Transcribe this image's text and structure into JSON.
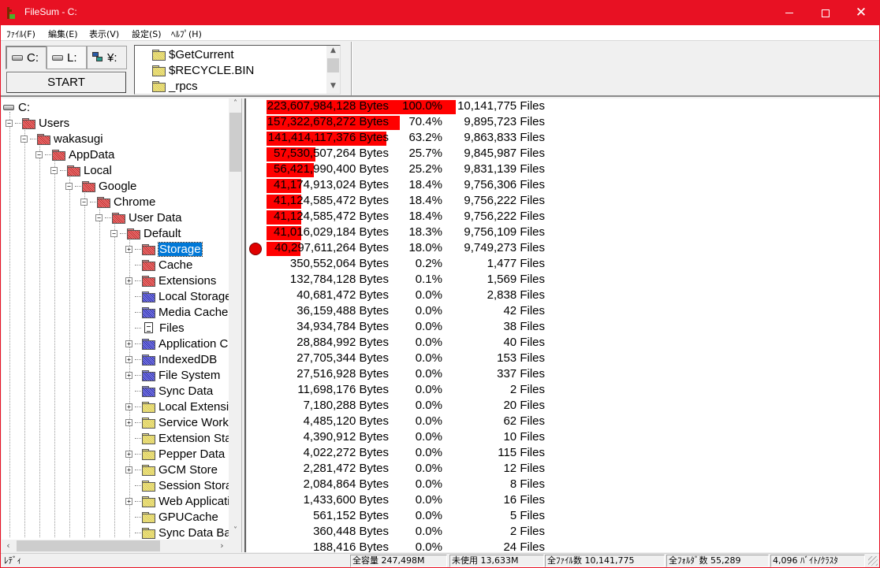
{
  "window": {
    "title": "FileSum - C:",
    "controls": {
      "minimize": "—",
      "maximize": "☐",
      "close": "✕"
    },
    "accent_color": "#e81123"
  },
  "menu": [
    {
      "label": "ﾌｧｲﾙ(F)"
    },
    {
      "label": "編集(E)"
    },
    {
      "label": "表示(V)"
    },
    {
      "label": "設定(S)"
    },
    {
      "label": "ﾍﾙﾌﾟ(H)"
    }
  ],
  "toolbar": {
    "drive_tabs": [
      {
        "label": "C:",
        "icon": "hdd-icon",
        "active": true
      },
      {
        "label": "L:",
        "icon": "hdd-icon",
        "active": false
      },
      {
        "label": "¥:",
        "icon": "network-drive-icon",
        "active": false
      }
    ],
    "start_label": "START",
    "folder_list": [
      {
        "name": "$GetCurrent"
      },
      {
        "name": "$RECYCLE.BIN"
      },
      {
        "name": "_rpcs"
      }
    ]
  },
  "tree": {
    "root": "C:",
    "items": [
      {
        "label": "Users",
        "depth": 1,
        "expander": "minus",
        "color": "red"
      },
      {
        "label": "wakasugi",
        "depth": 2,
        "expander": "minus",
        "color": "red"
      },
      {
        "label": "AppData",
        "depth": 3,
        "expander": "minus",
        "color": "red"
      },
      {
        "label": "Local",
        "depth": 4,
        "expander": "minus",
        "color": "red"
      },
      {
        "label": "Google",
        "depth": 5,
        "expander": "minus",
        "color": "red"
      },
      {
        "label": "Chrome",
        "depth": 6,
        "expander": "minus",
        "color": "red"
      },
      {
        "label": "User Data",
        "depth": 7,
        "expander": "minus",
        "color": "red"
      },
      {
        "label": "Default",
        "depth": 8,
        "expander": "minus",
        "color": "red"
      },
      {
        "label": "Storage",
        "depth": 9,
        "expander": "plus",
        "color": "red",
        "selected": true
      },
      {
        "label": "Cache",
        "depth": 9,
        "expander": "none",
        "color": "red"
      },
      {
        "label": "Extensions",
        "depth": 9,
        "expander": "plus",
        "color": "red"
      },
      {
        "label": "Local Storage",
        "depth": 9,
        "expander": "none",
        "color": "blue"
      },
      {
        "label": "Media Cache",
        "depth": 9,
        "expander": "none",
        "color": "blue"
      },
      {
        "label": "Files",
        "depth": 9,
        "expander": "none",
        "color": "file"
      },
      {
        "label": "Application C",
        "depth": 9,
        "expander": "plus",
        "color": "blue"
      },
      {
        "label": "IndexedDB",
        "depth": 9,
        "expander": "plus",
        "color": "blue"
      },
      {
        "label": "File System",
        "depth": 9,
        "expander": "plus",
        "color": "blue"
      },
      {
        "label": "Sync Data",
        "depth": 9,
        "expander": "none",
        "color": "blue"
      },
      {
        "label": "Local Extensic",
        "depth": 9,
        "expander": "plus",
        "color": "yellow"
      },
      {
        "label": "Service Worke",
        "depth": 9,
        "expander": "plus",
        "color": "yellow"
      },
      {
        "label": "Extension Stat",
        "depth": 9,
        "expander": "none",
        "color": "yellow"
      },
      {
        "label": "Pepper Data",
        "depth": 9,
        "expander": "plus",
        "color": "yellow"
      },
      {
        "label": "GCM Store",
        "depth": 9,
        "expander": "plus",
        "color": "yellow"
      },
      {
        "label": "Session Stora",
        "depth": 9,
        "expander": "none",
        "color": "yellow"
      },
      {
        "label": "Web Applicati",
        "depth": 9,
        "expander": "plus",
        "color": "yellow"
      },
      {
        "label": "GPUCache",
        "depth": 9,
        "expander": "none",
        "color": "yellow"
      },
      {
        "label": "Sync Data Ba",
        "depth": 9,
        "expander": "none",
        "color": "yellow"
      }
    ]
  },
  "list": {
    "bar_color": "#ff0000",
    "rows": [
      {
        "bytes": "223,607,984,128 Bytes",
        "percent": "100.0%",
        "fraction": 1.0,
        "files": "10,141,775 Files"
      },
      {
        "bytes": "157,322,678,272 Bytes",
        "percent": "70.4%",
        "fraction": 0.704,
        "files": "9,895,723 Files"
      },
      {
        "bytes": "141,414,117,376 Bytes",
        "percent": "63.2%",
        "fraction": 0.632,
        "files": "9,863,833 Files"
      },
      {
        "bytes": "57,530,507,264 Bytes",
        "percent": "25.7%",
        "fraction": 0.257,
        "files": "9,845,987 Files"
      },
      {
        "bytes": "56,421,990,400 Bytes",
        "percent": "25.2%",
        "fraction": 0.252,
        "files": "9,831,139 Files"
      },
      {
        "bytes": "41,174,913,024 Bytes",
        "percent": "18.4%",
        "fraction": 0.184,
        "files": "9,756,306 Files"
      },
      {
        "bytes": "41,124,585,472 Bytes",
        "percent": "18.4%",
        "fraction": 0.184,
        "files": "9,756,222 Files"
      },
      {
        "bytes": "41,124,585,472 Bytes",
        "percent": "18.4%",
        "fraction": 0.184,
        "files": "9,756,222 Files"
      },
      {
        "bytes": "41,016,029,184 Bytes",
        "percent": "18.3%",
        "fraction": 0.183,
        "files": "9,756,109 Files"
      },
      {
        "bytes": "40,297,611,264 Bytes",
        "percent": "18.0%",
        "fraction": 0.18,
        "files": "9,749,273 Files",
        "marker": true
      },
      {
        "bytes": "350,552,064 Bytes",
        "percent": "0.2%",
        "fraction": 0.002,
        "files": "1,477 Files"
      },
      {
        "bytes": "132,784,128 Bytes",
        "percent": "0.1%",
        "fraction": 0.001,
        "files": "1,569 Files"
      },
      {
        "bytes": "40,681,472 Bytes",
        "percent": "0.0%",
        "fraction": 0,
        "files": "2,838 Files"
      },
      {
        "bytes": "36,159,488 Bytes",
        "percent": "0.0%",
        "fraction": 0,
        "files": "42 Files"
      },
      {
        "bytes": "34,934,784 Bytes",
        "percent": "0.0%",
        "fraction": 0,
        "files": "38 Files"
      },
      {
        "bytes": "28,884,992 Bytes",
        "percent": "0.0%",
        "fraction": 0,
        "files": "40 Files"
      },
      {
        "bytes": "27,705,344 Bytes",
        "percent": "0.0%",
        "fraction": 0,
        "files": "153 Files"
      },
      {
        "bytes": "27,516,928 Bytes",
        "percent": "0.0%",
        "fraction": 0,
        "files": "337 Files"
      },
      {
        "bytes": "11,698,176 Bytes",
        "percent": "0.0%",
        "fraction": 0,
        "files": "2 Files"
      },
      {
        "bytes": "7,180,288 Bytes",
        "percent": "0.0%",
        "fraction": 0,
        "files": "20 Files"
      },
      {
        "bytes": "4,485,120 Bytes",
        "percent": "0.0%",
        "fraction": 0,
        "files": "62 Files"
      },
      {
        "bytes": "4,390,912 Bytes",
        "percent": "0.0%",
        "fraction": 0,
        "files": "10 Files"
      },
      {
        "bytes": "4,022,272 Bytes",
        "percent": "0.0%",
        "fraction": 0,
        "files": "115 Files"
      },
      {
        "bytes": "2,281,472 Bytes",
        "percent": "0.0%",
        "fraction": 0,
        "files": "12 Files"
      },
      {
        "bytes": "2,084,864 Bytes",
        "percent": "0.0%",
        "fraction": 0,
        "files": "8 Files"
      },
      {
        "bytes": "1,433,600 Bytes",
        "percent": "0.0%",
        "fraction": 0,
        "files": "16 Files"
      },
      {
        "bytes": "561,152 Bytes",
        "percent": "0.0%",
        "fraction": 0,
        "files": "5 Files"
      },
      {
        "bytes": "360,448 Bytes",
        "percent": "0.0%",
        "fraction": 0,
        "files": "2 Files"
      },
      {
        "bytes": "188,416 Bytes",
        "percent": "0.0%",
        "fraction": 0,
        "files": "24 Files"
      }
    ]
  },
  "status": {
    "state": "ﾚﾃﾞｨ",
    "total_capacity": "全容量 247,498M",
    "free": "未使用 13,633M",
    "total_files": "全ﾌｧｲﾙ数 10,141,775",
    "total_folders": "全ﾌｫﾙﾀﾞ数 55,289",
    "cluster": "4,096 ﾊﾞｲﾄ/ｸﾗｽﾀ"
  }
}
